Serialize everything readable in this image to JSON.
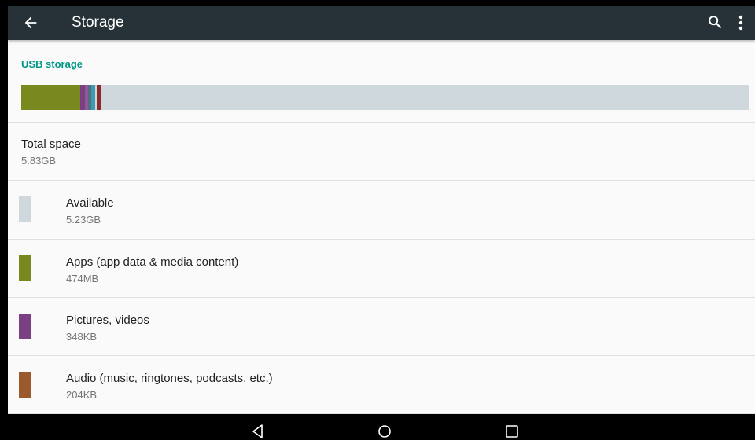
{
  "appbar": {
    "title": "Storage"
  },
  "section": {
    "header": "USB storage"
  },
  "usage_bar": {
    "background": "#cfd8dc",
    "segments": [
      {
        "category": "apps",
        "color": "#7a891f",
        "fraction": 0.081
      },
      {
        "category": "pictures",
        "color": "#7b3f84",
        "fraction": 0.006
      },
      {
        "category": "other-1",
        "color": "#8d5a9a",
        "fraction": 0.004
      },
      {
        "category": "other-2",
        "color": "#546e7a",
        "fraction": 0.004
      },
      {
        "category": "other-3",
        "color": "#3b9bb5",
        "fraction": 0.005
      },
      {
        "category": "other-4",
        "color": "#cfd8dc",
        "fraction": 0.002
      },
      {
        "category": "other-5",
        "color": "#8e2a2a",
        "fraction": 0.006
      }
    ]
  },
  "total": {
    "title": "Total space",
    "value": "5.83GB"
  },
  "items": [
    {
      "label": "Available",
      "size": "5.23GB",
      "color": "#cfd8dc"
    },
    {
      "label": "Apps (app data & media content)",
      "size": "474MB",
      "color": "#7a891f"
    },
    {
      "label": "Pictures, videos",
      "size": "348KB",
      "color": "#7b3f84"
    },
    {
      "label": "Audio (music, ringtones, podcasts, etc.)",
      "size": "204KB",
      "color": "#9b5a2e"
    }
  ],
  "icons": {
    "back": "arrow-left-icon",
    "search": "search-icon",
    "more": "more-vert-icon",
    "nav_back": "triangle-back-icon",
    "nav_home": "circle-home-icon",
    "nav_recents": "square-recents-icon"
  }
}
